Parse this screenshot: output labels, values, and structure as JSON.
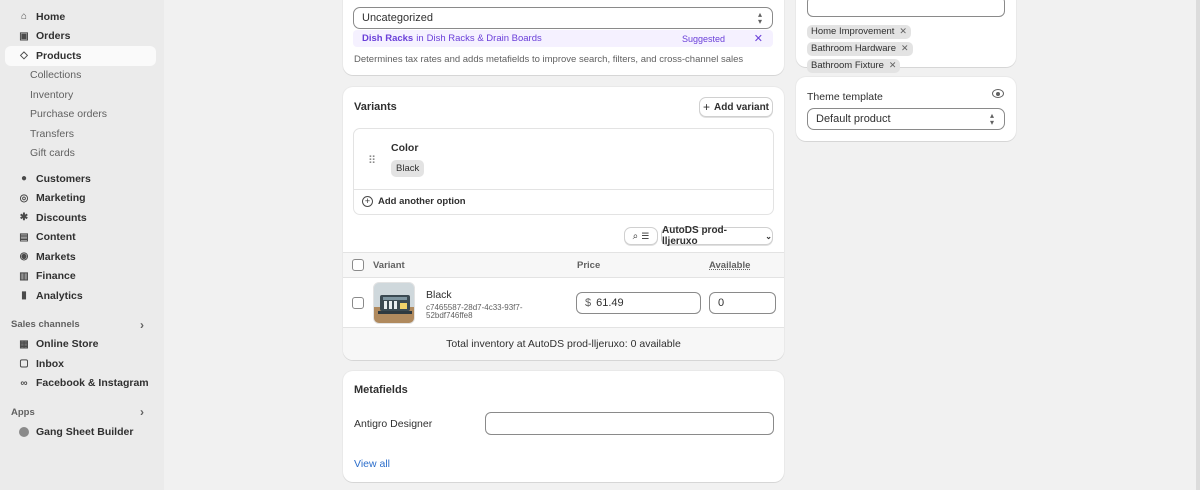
{
  "sidebar": {
    "main": [
      {
        "label": "Home",
        "icon": "home-icon",
        "glyph": "⌂"
      },
      {
        "label": "Orders",
        "icon": "orders-icon",
        "glyph": "▣"
      },
      {
        "label": "Products",
        "icon": "tag-icon",
        "glyph": "◇"
      }
    ],
    "product_subs": [
      "Collections",
      "Inventory",
      "Purchase orders",
      "Transfers",
      "Gift cards"
    ],
    "main2": [
      {
        "label": "Customers",
        "icon": "person-icon",
        "glyph": "●"
      },
      {
        "label": "Marketing",
        "icon": "target-icon",
        "glyph": "◎"
      },
      {
        "label": "Discounts",
        "icon": "discount-icon",
        "glyph": "✱"
      },
      {
        "label": "Content",
        "icon": "content-icon",
        "glyph": "▤"
      },
      {
        "label": "Markets",
        "icon": "globe-icon",
        "glyph": "◉"
      },
      {
        "label": "Finance",
        "icon": "bank-icon",
        "glyph": "▥"
      },
      {
        "label": "Analytics",
        "icon": "chart-icon",
        "glyph": "▮"
      }
    ],
    "sales_channels_label": "Sales channels",
    "sales_channels": [
      {
        "label": "Online Store",
        "icon": "store-icon",
        "glyph": "▦"
      },
      {
        "label": "Inbox",
        "icon": "inbox-icon",
        "glyph": "▢"
      },
      {
        "label": "Facebook & Instagram",
        "icon": "meta-icon",
        "glyph": "∞"
      }
    ],
    "apps_label": "Apps",
    "apps": [
      {
        "label": "Gang Sheet Builder",
        "icon": "app-icon"
      }
    ]
  },
  "category": {
    "value": "Uncategorized",
    "suggestion_category": "Dish Racks",
    "suggestion_in": "in",
    "suggestion_path": "Dish Racks & Drain Boards",
    "suggested_label": "Suggested",
    "help": "Determines tax rates and adds metafields to improve search, filters, and cross-channel sales"
  },
  "variants": {
    "title": "Variants",
    "add_variant_label": "Add variant",
    "option_name": "Color",
    "option_values": [
      "Black"
    ],
    "add_option_label": "Add another option",
    "location_label": "AutoDS prod-lljeruxo",
    "headers": {
      "variant": "Variant",
      "price": "Price",
      "available": "Available"
    },
    "rows": [
      {
        "name": "Black",
        "sku_line1": "c7465587-28d7-4c33-93f7-",
        "sku_line2": "52bdf746ffe8",
        "currency": "$",
        "price": "61.49",
        "available": "0"
      }
    ],
    "total_inventory": "Total inventory at AutoDS prod-lljeruxo: 0 available"
  },
  "metafields": {
    "title": "Metafields",
    "field_label": "Antigro Designer",
    "field_value": "",
    "view_all_label": "View all"
  },
  "organization": {
    "tags": [
      "Home Improvement",
      "Bathroom Hardware",
      "Bathroom Fixture"
    ]
  },
  "theme": {
    "title": "Theme template",
    "value": "Default product"
  },
  "colors": {
    "accent_link": "#2c6ecb",
    "suggest_purple": "#6a3fd9",
    "sidebar_bg": "#ebebeb",
    "page_bg": "#f1f1f1"
  }
}
